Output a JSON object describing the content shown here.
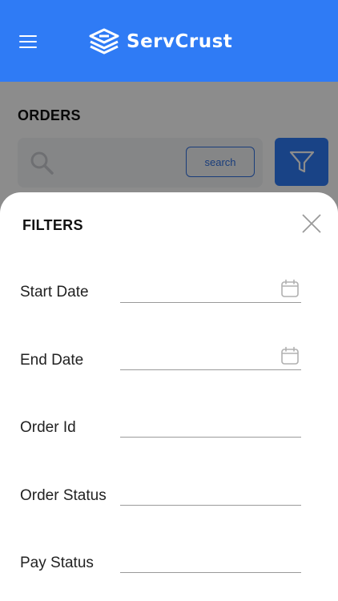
{
  "header": {
    "brand": "ServCrust",
    "menu_icon": "hamburger-menu-icon",
    "logo_icon": "servcrust-logo-icon",
    "background": "#2f7bf5"
  },
  "orders": {
    "title": "ORDERS",
    "search": {
      "icon": "search-icon",
      "placeholder": "",
      "button_label": "search"
    },
    "filter_button_icon": "filter-funnel-icon"
  },
  "filters": {
    "title": "FILTERS",
    "close_icon": "close-icon",
    "fields": [
      {
        "label": "Start Date",
        "value": "",
        "icon": "calendar-icon"
      },
      {
        "label": "End Date",
        "value": "",
        "icon": "calendar-icon"
      },
      {
        "label": "Order Id",
        "value": ""
      },
      {
        "label": "Order Status",
        "value": ""
      },
      {
        "label": "Pay Status",
        "value": ""
      }
    ]
  },
  "colors": {
    "accent": "#2f7bf5",
    "overlay": "rgba(0,0,0,0.45)"
  }
}
